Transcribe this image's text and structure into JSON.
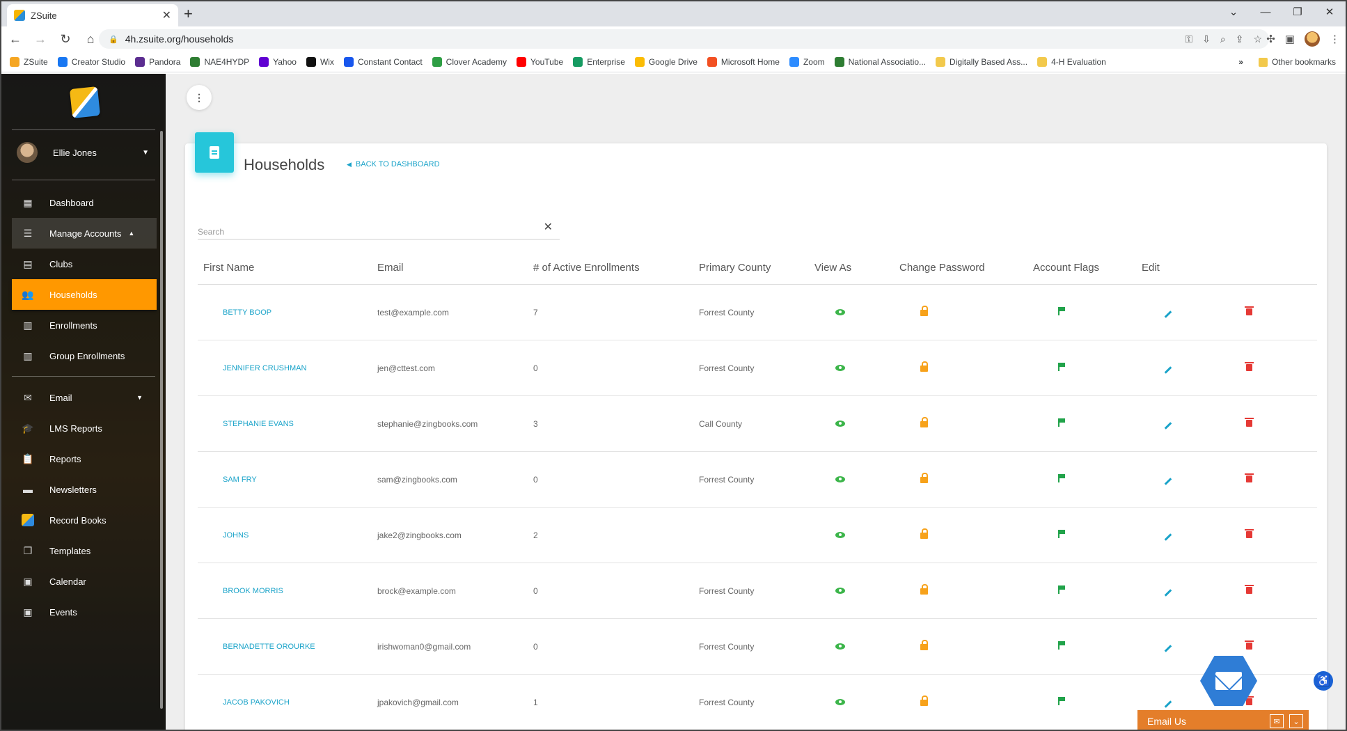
{
  "browser": {
    "tab_title": "ZSuite",
    "new_tab": "+",
    "url": "4h.zsuite.org/households",
    "bookmarks": [
      {
        "label": "ZSuite",
        "color": "#f5a623"
      },
      {
        "label": "Creator Studio",
        "color": "#1877f2"
      },
      {
        "label": "Pandora",
        "color": "#5b2d90"
      },
      {
        "label": "NAE4HYDP",
        "color": "#2e7d32"
      },
      {
        "label": "Yahoo",
        "color": "#6001d2"
      },
      {
        "label": "Wix",
        "color": "#111111"
      },
      {
        "label": "Constant Contact",
        "color": "#1856ed"
      },
      {
        "label": "Clover Academy",
        "color": "#2e9e44"
      },
      {
        "label": "YouTube",
        "color": "#ff0000"
      },
      {
        "label": "Enterprise",
        "color": "#169b62"
      },
      {
        "label": "Google Drive",
        "color": "#fbbc04"
      },
      {
        "label": "Microsoft Home",
        "color": "#f25022"
      },
      {
        "label": "Zoom",
        "color": "#2d8cff"
      },
      {
        "label": "National Associatio...",
        "color": "#2e7d32"
      },
      {
        "label": "Digitally Based Ass...",
        "color": "#f2c94c"
      },
      {
        "label": "4-H Evaluation",
        "color": "#f2c94c"
      }
    ],
    "more_bookmarks": "»",
    "other_bookmarks": "Other bookmarks"
  },
  "sidebar": {
    "user_name": "Ellie Jones",
    "items": [
      {
        "label": "Dashboard"
      },
      {
        "label": "Manage Accounts"
      },
      {
        "label": "Clubs"
      },
      {
        "label": "Households"
      },
      {
        "label": "Enrollments"
      },
      {
        "label": "Group Enrollments"
      },
      {
        "label": "Email"
      },
      {
        "label": "LMS Reports"
      },
      {
        "label": "Reports"
      },
      {
        "label": "Newsletters"
      },
      {
        "label": "Record Books"
      },
      {
        "label": "Templates"
      },
      {
        "label": "Calendar"
      },
      {
        "label": "Events"
      }
    ],
    "accent_color": "#ff9800"
  },
  "main": {
    "title": "Households",
    "back_link": "BACK TO DASHBOARD",
    "search_placeholder": "Search",
    "columns": [
      "First Name",
      "Email",
      "# of Active Enrollments",
      "Primary County",
      "View As",
      "Change Password",
      "Account Flags",
      "Edit"
    ],
    "rows": [
      {
        "name": "BETTY BOOP",
        "email": "test@example.com",
        "enrollments": "7",
        "county": "Forrest County"
      },
      {
        "name": "JENNIFER CRUSHMAN",
        "email": "jen@cttest.com",
        "enrollments": "0",
        "county": "Forrest County"
      },
      {
        "name": "STEPHANIE EVANS",
        "email": "stephanie@zingbooks.com",
        "enrollments": "3",
        "county": "Call County"
      },
      {
        "name": "SAM FRY",
        "email": "sam@zingbooks.com",
        "enrollments": "0",
        "county": "Forrest County"
      },
      {
        "name": "JOHNS",
        "email": "jake2@zingbooks.com",
        "enrollments": "2",
        "county": ""
      },
      {
        "name": "BROOK MORRIS",
        "email": "brock@example.com",
        "enrollments": "0",
        "county": "Forrest County"
      },
      {
        "name": "BERNADETTE OROURKE",
        "email": "irishwoman0@gmail.com",
        "enrollments": "0",
        "county": "Forrest County"
      },
      {
        "name": "JACOB PAKOVICH",
        "email": "jpakovich@gmail.com",
        "enrollments": "1",
        "county": "Forrest County"
      }
    ],
    "icon_colors": {
      "view": "#3cb54a",
      "password": "#f7a21b",
      "flag": "#21a34a",
      "edit": "#1aa3c9",
      "delete": "#e53935"
    }
  },
  "widgets": {
    "email_us_label": "Email Us"
  }
}
